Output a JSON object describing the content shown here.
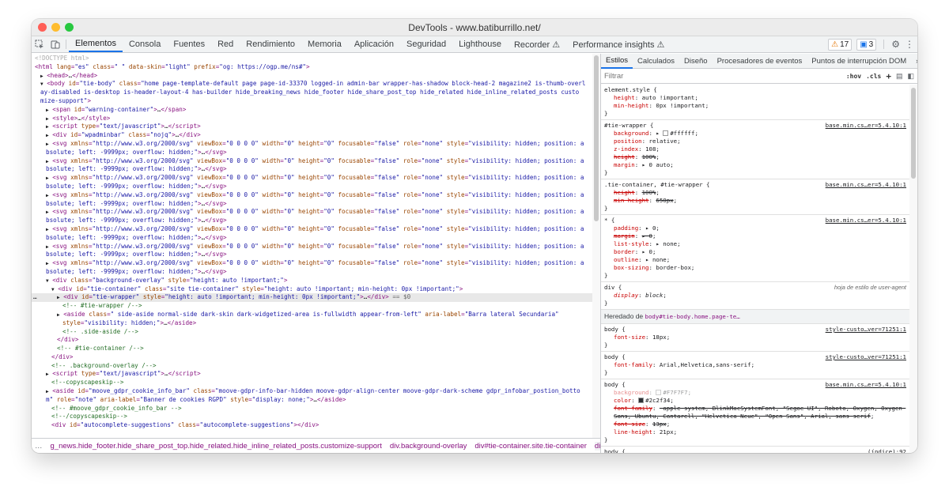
{
  "window": {
    "title": "DevTools - www.batiburrillo.net/"
  },
  "toolbar": {
    "tabs": [
      "Elementos",
      "Consola",
      "Fuentes",
      "Red",
      "Rendimiento",
      "Memoria",
      "Aplicación",
      "Seguridad",
      "Lighthouse",
      "Recorder ⚠",
      "Performance insights ⚠"
    ],
    "active_tab": "Elementos",
    "warnings_count": "17",
    "messages_count": "3"
  },
  "elements": {
    "lines": [
      {
        "indent": 0,
        "tri": "",
        "html": "&lt;!DOCTYPE html&gt;",
        "dt": true
      },
      {
        "indent": 0,
        "tri": "",
        "html": "<span class='tg'>&lt;html</span> <span class='an'>lang</span>=<span class='av'>\"es\"</span> <span class='an'>class</span>=<span class='av'>\" \"</span> <span class='an'>data-skin</span>=<span class='av'>\"light\"</span> <span class='an'>prefix</span>=<span class='av'>\"og: https://ogp.me/ns#\"</span><span class='tg'>&gt;</span>"
      },
      {
        "indent": 1,
        "tri": "▶",
        "html": "<span class='tg'>&lt;head&gt;</span><span class='gt'>…</span><span class='tg'>&lt;/head&gt;</span>"
      },
      {
        "indent": 1,
        "tri": "▼",
        "html": "<span class='tg'>&lt;body</span> <span class='an'>id</span>=<span class='av'>\"tie-body\"</span> <span class='an'>class</span>=<span class='av'>\"home page-template-default page page-id-33370 logged-in admin-bar wrapper-has-shadow block-head-2 magazine2 is-thumb-overl</span>"
      },
      {
        "indent": 1,
        "tri": "",
        "html": "<span class='av'>ay-disabled is-desktop is-header-layout-4 has-builder hide_breaking_news hide_footer hide_share_post_top hide_related hide_inline_related_posts custo</span>"
      },
      {
        "indent": 1,
        "tri": "",
        "html": "<span class='av'>mize-support\"</span><span class='tg'>&gt;</span>"
      },
      {
        "indent": 2,
        "tri": "▶",
        "html": "<span class='tg'>&lt;span</span> <span class='an'>id</span>=<span class='av'>\"warning-container\"</span><span class='tg'>&gt;</span><span class='gt'>…</span><span class='tg'>&lt;/span&gt;</span>"
      },
      {
        "indent": 2,
        "tri": "▶",
        "html": "<span class='tg'>&lt;style&gt;</span><span class='gt'>…</span><span class='tg'>&lt;/style&gt;</span>"
      },
      {
        "indent": 2,
        "tri": "▶",
        "html": "<span class='tg'>&lt;script</span> <span class='an'>type</span>=<span class='av'>\"text/javascript\"</span><span class='tg'>&gt;</span><span class='gt'>…</span><span class='tg'>&lt;/script&gt;</span>"
      },
      {
        "indent": 2,
        "tri": "▶",
        "html": "<span class='tg'>&lt;div</span> <span class='an'>id</span>=<span class='av'>\"wpadminbar\"</span> <span class='an'>class</span>=<span class='av'>\"nojq\"</span><span class='tg'>&gt;</span><span class='gt'>…</span><span class='tg'>&lt;/div&gt;</span>"
      },
      {
        "indent": 2,
        "tri": "▶",
        "svg": true
      },
      {
        "indent": 2,
        "tri": "",
        "svg2": true
      },
      {
        "indent": 2,
        "tri": "▶",
        "svg": true
      },
      {
        "indent": 2,
        "tri": "",
        "svg2": true
      },
      {
        "indent": 2,
        "tri": "▶",
        "svg": true
      },
      {
        "indent": 2,
        "tri": "",
        "svg2": true
      },
      {
        "indent": 2,
        "tri": "▶",
        "svg": true
      },
      {
        "indent": 2,
        "tri": "",
        "svg2": true
      },
      {
        "indent": 2,
        "tri": "▶",
        "svg": true
      },
      {
        "indent": 2,
        "tri": "",
        "svg2": true
      },
      {
        "indent": 2,
        "tri": "▶",
        "svg": true
      },
      {
        "indent": 2,
        "tri": "",
        "svg2": true
      },
      {
        "indent": 2,
        "tri": "▶",
        "svg": true
      },
      {
        "indent": 2,
        "tri": "",
        "svg2": true
      },
      {
        "indent": 2,
        "tri": "▶",
        "svg": true
      },
      {
        "indent": 2,
        "tri": "",
        "svg2": true
      },
      {
        "indent": 2,
        "tri": "▼",
        "html": "<span class='tg'>&lt;div</span> <span class='an'>class</span>=<span class='av'>\"background-overlay\"</span> <span class='an'>style</span>=<span class='av'>\"height: auto !important;\"</span><span class='tg'>&gt;</span>"
      },
      {
        "indent": 3,
        "tri": "▼",
        "html": "<span class='tg'>&lt;div</span> <span class='an'>id</span>=<span class='av'>\"tie-container\"</span> <span class='an'>class</span>=<span class='av'>\"site tie-container\"</span> <span class='an'>style</span>=<span class='av'>\"height: auto !important; min-height: 0px !important;\"</span><span class='tg'>&gt;</span>"
      },
      {
        "indent": 4,
        "tri": "▶",
        "hl": true,
        "html": "<span class='tg'>&lt;div</span> <span class='an'>id</span>=<span class='av'>\"tie-wrapper\"</span> <span class='an'>style</span>=<span class='av'>\"height: auto !important; min-height: 0px !important;\"</span><span class='tg'>&gt;</span><span class='gt'>…</span><span class='tg'>&lt;/div&gt;</span> <span class='dm'>== $0</span>"
      },
      {
        "indent": 5,
        "tri": "",
        "html": "<span class='cm'>&lt;!-- #tie-wrapper /--&gt;</span>"
      },
      {
        "indent": 4,
        "tri": "▶",
        "html": "<span class='tg'>&lt;aside</span> <span class='an'>class</span>=<span class='av'>\" side-aside normal-side dark-skin dark-widgetized-area is-fullwidth appear-from-left\"</span> <span class='an'>aria-label</span>=<span class='av'>\"Barra lateral Secundaria\"</span>"
      },
      {
        "indent": 5,
        "tri": "",
        "html": "<span class='an'>style</span>=<span class='av'>\"visibility: hidden;\"</span><span class='tg'>&gt;</span><span class='gt'>…</span><span class='tg'>&lt;/aside&gt;</span>"
      },
      {
        "indent": 5,
        "tri": "",
        "html": "<span class='cm'>&lt;!-- .side-aside /--&gt;</span>"
      },
      {
        "indent": 4,
        "tri": "",
        "html": "<span class='tg'>&lt;/div&gt;</span>"
      },
      {
        "indent": 4,
        "tri": "",
        "html": "<span class='cm'>&lt;!-- #tie-container /--&gt;</span>"
      },
      {
        "indent": 3,
        "tri": "",
        "html": "<span class='tg'>&lt;/div&gt;</span>"
      },
      {
        "indent": 3,
        "tri": "",
        "html": "<span class='cm'>&lt;!-- .background-overlay /--&gt;</span>"
      },
      {
        "indent": 2,
        "tri": "▶",
        "html": "<span class='tg'>&lt;script</span> <span class='an'>type</span>=<span class='av'>\"text/javascript\"</span><span class='tg'>&gt;</span><span class='gt'>…</span><span class='tg'>&lt;/script&gt;</span>"
      },
      {
        "indent": 3,
        "tri": "",
        "html": "<span class='cm'>&lt;!--copyscapeskip--&gt;</span>"
      },
      {
        "indent": 2,
        "tri": "▶",
        "html": "<span class='tg'>&lt;aside</span> <span class='an'>id</span>=<span class='av'>\"moove_gdpr_cookie_info_bar\"</span> <span class='an'>class</span>=<span class='av'>\"moove-gdpr-info-bar-hidden moove-gdpr-align-center moove-gdpr-dark-scheme gdpr_infobar_postion_botto</span>"
      },
      {
        "indent": 2,
        "tri": "",
        "html": "<span class='av'>m\"</span> <span class='an'>role</span>=<span class='av'>\"note\"</span> <span class='an'>aria-label</span>=<span class='av'>\"Banner de cookies RGPD\"</span> <span class='an'>style</span>=<span class='av'>\"display: none;\"</span><span class='tg'>&gt;</span><span class='gt'>…</span><span class='tg'>&lt;/aside&gt;</span>"
      },
      {
        "indent": 3,
        "tri": "",
        "html": "<span class='cm'>&lt;!-- #moove_gdpr_cookie_info_bar --&gt;</span>"
      },
      {
        "indent": 3,
        "tri": "",
        "html": "<span class='cm'>&lt;!--/copyscapeskip--&gt;</span>"
      },
      {
        "indent": 3,
        "tri": "",
        "html": "<span class='tg'>&lt;div</span> <span class='an'>id</span>=<span class='av'>\"autocomplete-suggestions\"</span> <span class='an'>class</span>=<span class='av'>\"autocomplete-suggestions\"</span><span class='tg'>&gt;&lt;/div&gt;</span>"
      }
    ],
    "svg_line": "<span class='tg'>&lt;svg</span> <span class='an'>xmlns</span>=<span class='av'>\"http://www.w3.org/2000/svg\"</span> <span class='an'>viewBox</span>=<span class='av'>\"0 0 0 0\"</span> <span class='an'>width</span>=<span class='av'>\"0\"</span> <span class='an'>height</span>=<span class='av'>\"0\"</span> <span class='an'>focusable</span>=<span class='av'>\"false\"</span> <span class='an'>role</span>=<span class='av'>\"none\"</span> <span class='an'>style</span>=<span class='av'>\"visibility: hidden; position: a</span>",
    "svg_line2": "<span class='av'>bsolute; left: -9999px; overflow: hidden;\"</span><span class='tg'>&gt;</span><span class='gt'>…</span><span class='tg'>&lt;/svg&gt;</span>",
    "breadcrumbs": [
      "g_news.hide_footer.hide_share_post_top.hide_related.hide_inline_related_posts.customize-support",
      "div.background-overlay",
      "div#tie-container.site.tie-container",
      "div#tie-wrapper"
    ],
    "gutter_dots": "…"
  },
  "styles": {
    "tabs": [
      "Estilos",
      "Calculados",
      "Diseño",
      "Procesadores de eventos",
      "Puntos de interrupción DOM",
      "»"
    ],
    "active_tab": "Estilos",
    "filter_placeholder": "Filtrar",
    "hov": ":hov",
    "cls": ".cls",
    "add": "+",
    "inherited_label": "Heredado de",
    "inherited_from": "body#tie-body.home.page-te…",
    "rules": [
      {
        "selector": "element.style {",
        "source": "",
        "decls": [
          [
            "height",
            "auto !important",
            ""
          ],
          [
            "min-height",
            "0px !important",
            ""
          ]
        ]
      },
      {
        "selector": "#tie-wrapper {",
        "source": "base.min.cs…er=5.4.10:1",
        "decls": [
          [
            "background",
            "▸ □#ffffff",
            ""
          ],
          [
            "position",
            "relative",
            ""
          ],
          [
            "z-index",
            "108",
            ""
          ],
          [
            "height",
            "100%",
            "strike"
          ],
          [
            "margin",
            "▸ 0 auto",
            ""
          ]
        ]
      },
      {
        "selector": ".tie-container, #tie-wrapper {",
        "source": "base.min.cs…er=5.4.10:1",
        "decls": [
          [
            "height",
            "100%",
            "strike"
          ],
          [
            "min-height",
            "650px",
            "strike"
          ]
        ]
      },
      {
        "selector": "* {",
        "source": "base.min.cs…er=5.4.10:1",
        "decls": [
          [
            "padding",
            "▸ 0",
            ""
          ],
          [
            "margin",
            "▸ 0",
            "strike"
          ],
          [
            "list-style",
            "▸ none",
            ""
          ],
          [
            "border",
            "▸ 0",
            ""
          ],
          [
            "outline",
            "▸ none",
            ""
          ],
          [
            "box-sizing",
            "border-box",
            ""
          ]
        ]
      },
      {
        "selector": "div {",
        "source": "hoja de estilo de user-agent",
        "ua": true,
        "decls": [
          [
            "display",
            "block",
            "ua"
          ]
        ]
      }
    ],
    "inherited_rules": [
      {
        "selector": "body {",
        "source": "style-custo…ver=71251:1",
        "decls": [
          [
            "font-size",
            "18px",
            ""
          ]
        ]
      },
      {
        "selector": "body {",
        "source": "style-custo…ver=71251:1",
        "decls": [
          [
            "font-family",
            "Arial,Helvetica,sans-serif",
            ""
          ]
        ]
      },
      {
        "selector": "body {",
        "source": "base.min.cs…er=5.4.10:1",
        "decls": [
          [
            "background",
            "□#F7F7F7",
            "muted"
          ],
          [
            "color",
            "■#2c2f34",
            ""
          ],
          [
            "font-family",
            "-apple-system, BlinkMacSystemFont, \"Segoe UI\", Roboto, Oxygen, Oxygen-Sans, Ubuntu, Cantarell, \"Helvetica Neue\", \"Open Sans\", Arial, sans-serif",
            "strike"
          ],
          [
            "font-size",
            "13px",
            "strike"
          ],
          [
            "line-height",
            "21px",
            ""
          ]
        ]
      },
      {
        "selector": "body {",
        "source": "(índice):92",
        "decls": []
      }
    ]
  }
}
